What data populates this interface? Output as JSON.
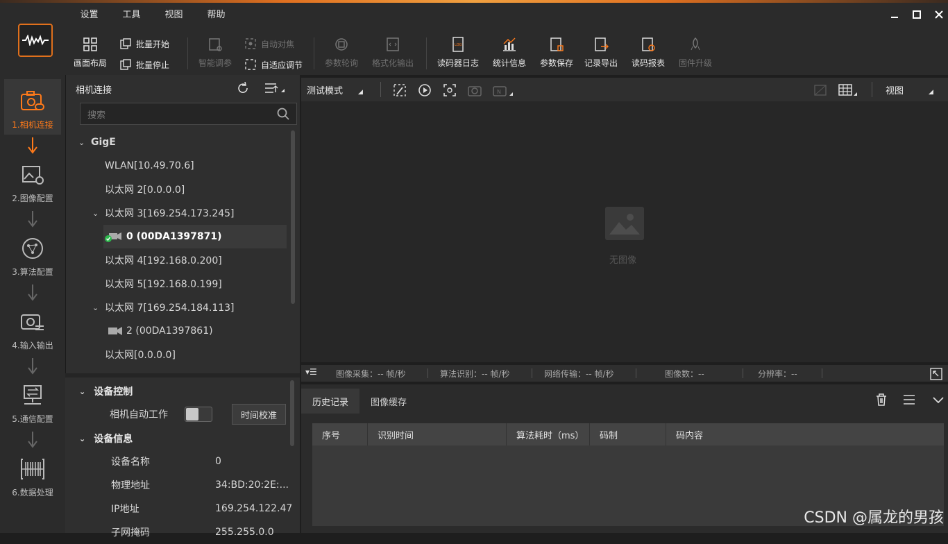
{
  "menu": [
    "设置",
    "工具",
    "视图",
    "帮助"
  ],
  "toolbar": {
    "layout": "画面布局",
    "batch_start": "批量开始",
    "batch_stop": "批量停止",
    "smart_tune": "智能调参",
    "auto_focus": "自动对焦",
    "adaptive_adjust": "自适应调节",
    "param_poll": "参数轮询",
    "format_output": "格式化输出",
    "reader_log": "读码器日志",
    "stats": "统计信息",
    "param_save": "参数保存",
    "record_export": "记录导出",
    "read_report": "读码报表",
    "firmware_upgrade": "固件升级"
  },
  "steps": [
    "1.相机连接",
    "2.图像配置",
    "3.算法配置",
    "4.输入输出",
    "5.通信配置",
    "6.数据处理"
  ],
  "left_panel": {
    "title": "相机连接",
    "search_placeholder": "搜索",
    "tree": {
      "root": "GigE",
      "items": [
        "WLAN[10.49.70.6]",
        "以太网 2[0.0.0.0]",
        "以太网 3[169.254.173.245]",
        "0 (00DA1397871)",
        "以太网 4[192.168.0.200]",
        "以太网 5[192.168.0.199]",
        "以太网 7[169.254.184.113]",
        "2 (00DA1397861)",
        "以太网[0.0.0.0]"
      ]
    },
    "device_control": {
      "title": "设备控制",
      "auto_work_label": "相机自动工作",
      "auto_work_on": false,
      "time_sync_button": "时间校准"
    },
    "device_info": {
      "title": "设备信息",
      "rows": [
        {
          "k": "设备名称",
          "v": "0"
        },
        {
          "k": "物理地址",
          "v": "34:BD:20:2E:..."
        },
        {
          "k": "IP地址",
          "v": "169.254.122.47"
        },
        {
          "k": "子网掩码",
          "v": "255.255.0.0"
        }
      ]
    }
  },
  "view": {
    "mode": "测试模式",
    "view_menu": "视图",
    "no_image": "无图像"
  },
  "status": {
    "capture": "图像采集：-- 帧/秒",
    "algo": "算法识别：-- 帧/秒",
    "network": "网络传输：-- 帧/秒",
    "image_count": "图像数：--",
    "resolution": "分辨率：--"
  },
  "bottom": {
    "tabs": [
      "历史记录",
      "图像缓存"
    ],
    "columns": [
      "序号",
      "识别时间",
      "算法耗时（ms）",
      "码制",
      "码内容"
    ]
  },
  "watermark": "CSDN @属龙的男孩",
  "colors": {
    "accent": "#ff7a1a",
    "bg": "#1e1e1e",
    "panel": "#2f2f2f",
    "ok": "#2db84d"
  }
}
